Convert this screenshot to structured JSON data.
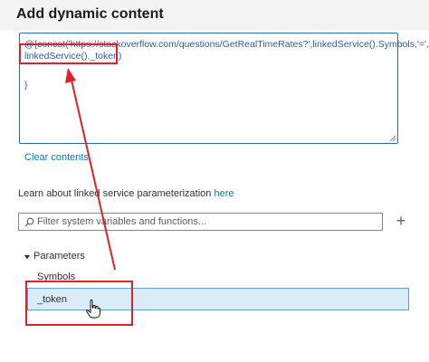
{
  "panel": {
    "title": "Add dynamic content"
  },
  "expression": {
    "line1": "@{concat('https://stackoverflow.com/questions/GetRealTimeRates?',linkedService().Symbols,'=',",
    "line2": "linkedService()._token)",
    "line3": "}"
  },
  "clear_contents_label": "Clear contents",
  "learn": {
    "prefix": "Learn about linked service parameterization ",
    "link_label": "here"
  },
  "search": {
    "placeholder": "Filter system variables and functions...",
    "value": ""
  },
  "parameters": {
    "section_label": "Parameters",
    "items": [
      {
        "label": "Symbols"
      },
      {
        "label": "_token"
      }
    ]
  },
  "colors": {
    "annotation_red": "#e0202a",
    "selection_bg": "#dcecf7",
    "link_blue": "#0078d4",
    "code_blue": "#2f5aa8"
  },
  "icons": [
    "search-icon",
    "plus-icon",
    "caret-down-icon",
    "hand-cursor-icon",
    "resize-grip-icon"
  ]
}
